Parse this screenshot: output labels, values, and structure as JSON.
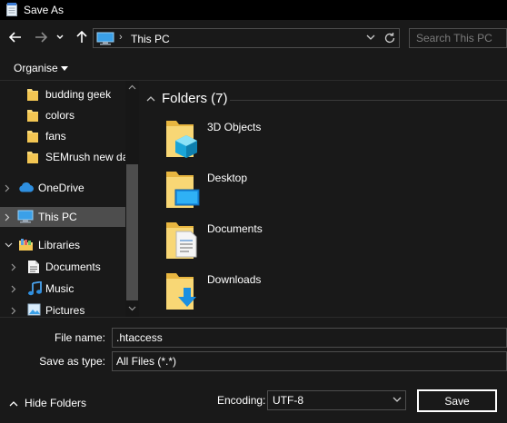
{
  "window": {
    "title": "Save As"
  },
  "address": {
    "location": "This PC"
  },
  "search": {
    "placeholder": "Search This PC"
  },
  "toolbar": {
    "organise_label": "Organise"
  },
  "navigation": {
    "items": [
      {
        "label": "budding geek",
        "icon": "folder-icon"
      },
      {
        "label": "colors",
        "icon": "folder-icon"
      },
      {
        "label": "fans",
        "icon": "folder-icon"
      },
      {
        "label": "SEMrush new da",
        "icon": "folder-icon"
      },
      {
        "label": "OneDrive",
        "icon": "cloud-icon"
      },
      {
        "label": "This PC",
        "icon": "computer-icon",
        "selected": true
      },
      {
        "label": "Libraries",
        "icon": "libraries-icon"
      },
      {
        "label": "Documents",
        "icon": "document-icon"
      },
      {
        "label": "Music",
        "icon": "music-icon"
      },
      {
        "label": "Pictures",
        "icon": "pictures-icon"
      }
    ]
  },
  "content": {
    "group_title": "Folders (7)",
    "folders": [
      {
        "name": "3D Objects",
        "icon": "3d-objects-folder-icon"
      },
      {
        "name": "Desktop",
        "icon": "desktop-folder-icon"
      },
      {
        "name": "Documents",
        "icon": "documents-folder-icon"
      },
      {
        "name": "Downloads",
        "icon": "downloads-folder-icon"
      }
    ]
  },
  "form": {
    "file_name_label": "File name:",
    "file_name_value": ".htaccess",
    "save_type_label": "Save as type:",
    "save_type_value": "All Files  (*.*)",
    "hide_folders_label": "Hide Folders",
    "encoding_label": "Encoding:",
    "encoding_value": "UTF-8",
    "save_label": "Save"
  },
  "colors": {
    "background": "#191919",
    "titlebar": "#000000",
    "selected": "#4d4d4d",
    "folder_yellow": "#f8d775"
  }
}
